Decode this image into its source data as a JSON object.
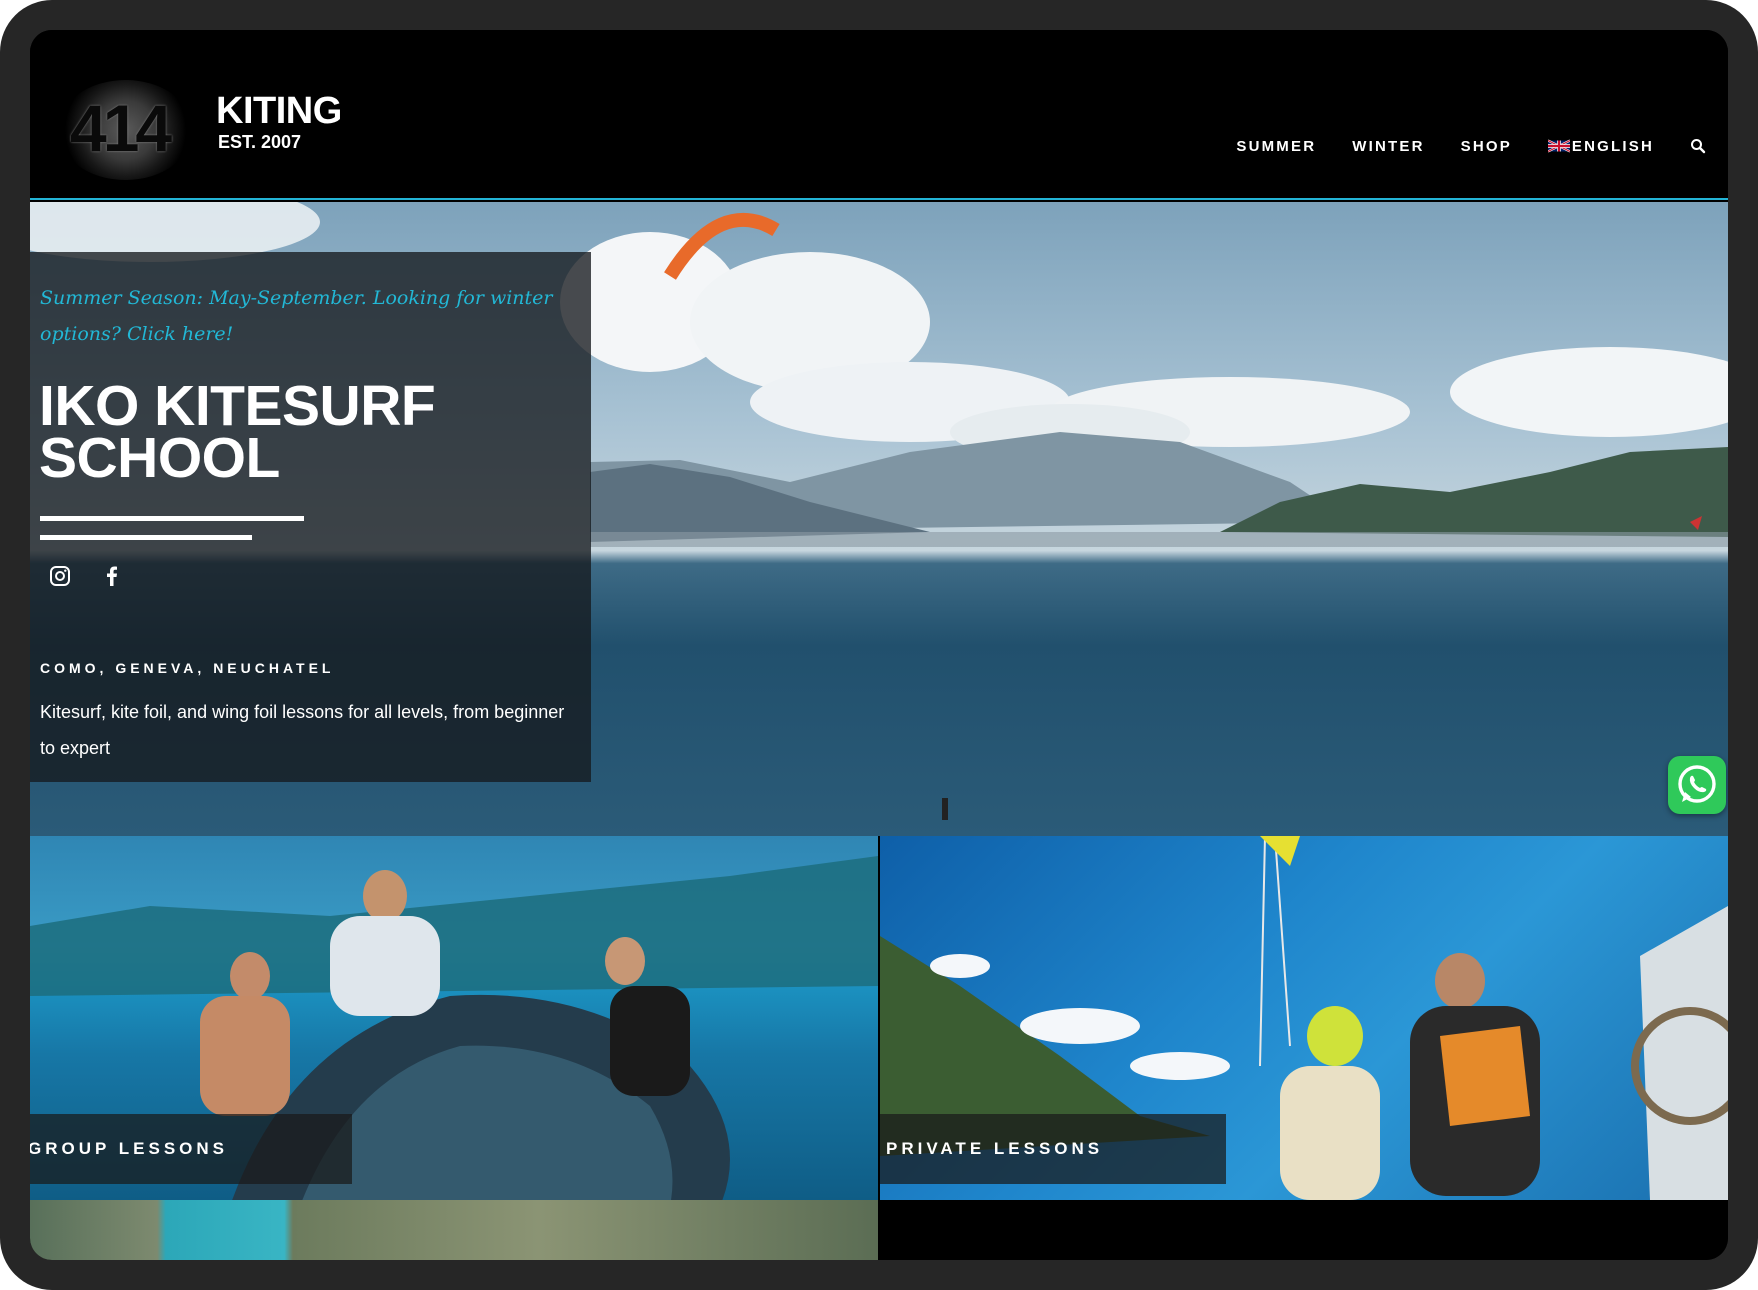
{
  "brand": {
    "logo_number": "414",
    "logo_word": "KITING",
    "logo_est": "EST. 2007"
  },
  "nav": {
    "items": [
      {
        "label": "SUMMER"
      },
      {
        "label": "WINTER"
      },
      {
        "label": "SHOP"
      },
      {
        "label": "ENGLISH",
        "icon": "uk-flag-icon"
      }
    ],
    "search_icon": "search-icon"
  },
  "hero": {
    "tagline": "Summer Season: May-September. Looking for winter options? Click here!",
    "title_line1": "IKO KITESURF",
    "title_line2": "SCHOOL",
    "social": [
      "instagram-icon",
      "facebook-icon"
    ],
    "locations": "COMO, GENEVA, NEUCHATEL",
    "description": "Kitesurf, kite foil, and wing foil lessons for all levels, from beginner to expert"
  },
  "tiles": [
    {
      "label": "GROUP LESSONS"
    },
    {
      "label": "PRIVATE LESSONS"
    }
  ],
  "colors": {
    "accent": "#22b8d6",
    "whatsapp": "#2fc95a",
    "header_bg": "#000000"
  },
  "floating": {
    "whatsapp_icon": "whatsapp-icon"
  }
}
